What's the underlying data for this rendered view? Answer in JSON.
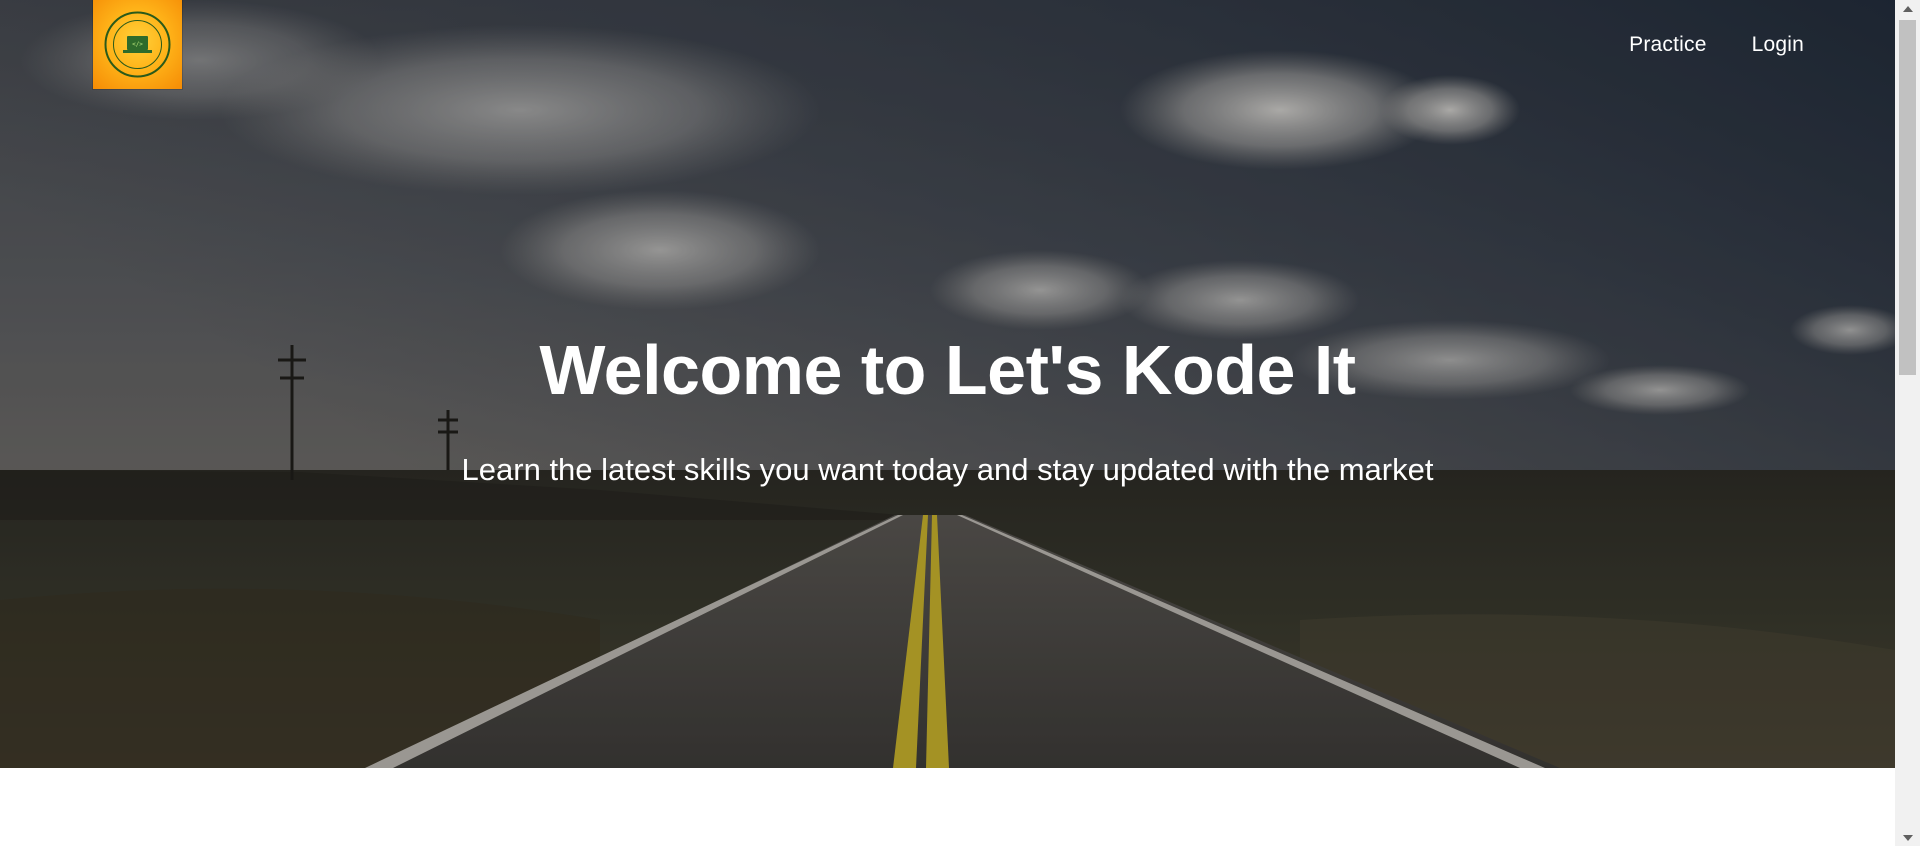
{
  "brand": {
    "logo_name": "Let's Kode It logo",
    "logo_text_top": "LET'S KODE IT",
    "logo_text_bottom": "ANYONE CAN CODE"
  },
  "nav": {
    "items": [
      {
        "label": "Practice"
      },
      {
        "label": "Login"
      }
    ]
  },
  "hero": {
    "title": "Welcome to Let's Kode It",
    "subtitle": "Learn the latest skills you want today and stay updated with the market"
  },
  "colors": {
    "sky_top": "#3b4048",
    "road": "#4a4a48",
    "lane_yellow": "#c7b12b",
    "logo_orange": "#f58b05"
  },
  "icons": {
    "scroll_up": "triangle-up",
    "scroll_down": "triangle-down"
  }
}
